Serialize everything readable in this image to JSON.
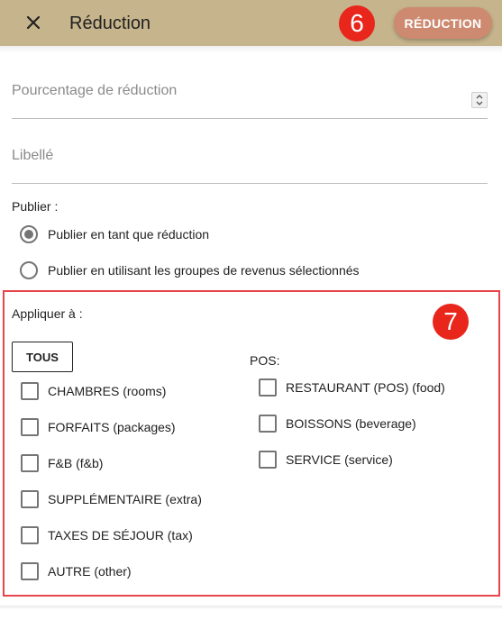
{
  "header": {
    "title": "Réduction",
    "action_label": "RÉDUCTION",
    "badge": "6",
    "close_icon": "close-icon"
  },
  "form": {
    "percent_placeholder": "Pourcentage de réduction",
    "percent_value": "",
    "label_placeholder": "Libellé",
    "label_value": ""
  },
  "publish": {
    "label": "Publier :",
    "options": [
      {
        "label": "Publier en tant que réduction",
        "checked": true
      },
      {
        "label": "Publier en utilisant les groupes de revenus sélectionnés",
        "checked": false
      }
    ]
  },
  "apply": {
    "label": "Appliquer à :",
    "badge": "7",
    "all_button": "TOUS",
    "pos_label": "POS:",
    "left_items": [
      {
        "label": "CHAMBRES (rooms)",
        "checked": false
      },
      {
        "label": "FORFAITS (packages)",
        "checked": false
      },
      {
        "label": "F&B (f&b)",
        "checked": false
      },
      {
        "label": "SUPPLÉMENTAIRE (extra)",
        "checked": false
      },
      {
        "label": "TAXES DE SÉJOUR (tax)",
        "checked": false
      },
      {
        "label": "AUTRE (other)",
        "checked": false
      }
    ],
    "pos_items": [
      {
        "label": "RESTAURANT (POS) (food)",
        "checked": false
      },
      {
        "label": "BOISSONS (beverage)",
        "checked": false
      },
      {
        "label": "SERVICE (service)",
        "checked": false
      }
    ]
  },
  "colors": {
    "header_bg": "#c6b48c",
    "accent_button": "#cd8a70",
    "annotation_red": "#e8261c"
  }
}
